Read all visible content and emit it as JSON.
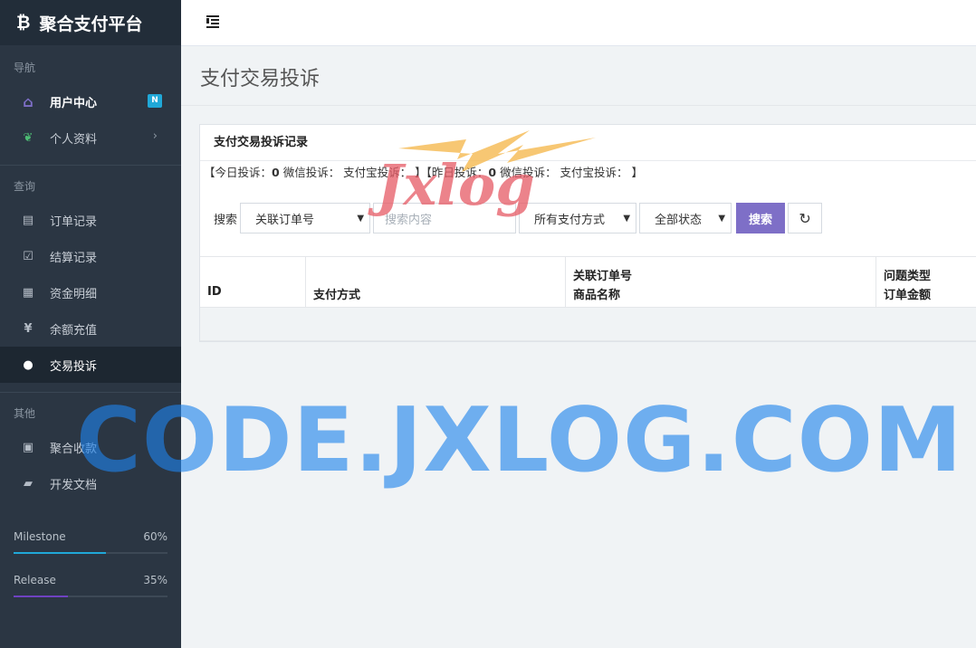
{
  "brand": {
    "logo_glyph": "₿",
    "title": "聚合支付平台"
  },
  "sidebar": {
    "sections": [
      {
        "label": "导航"
      },
      {
        "label": "查询"
      },
      {
        "label": "其他"
      }
    ],
    "items": [
      {
        "label": "用户中心",
        "icon": "home-icon",
        "glyph": "⌂",
        "badge": "N"
      },
      {
        "label": "个人资料",
        "icon": "leaf-icon",
        "glyph": "❦",
        "chevron": "›"
      },
      {
        "label": "订单记录",
        "icon": "list-icon",
        "glyph": "▤"
      },
      {
        "label": "结算记录",
        "icon": "check-square-icon",
        "glyph": "☑"
      },
      {
        "label": "资金明细",
        "icon": "calendar-icon",
        "glyph": "▦"
      },
      {
        "label": "余额充值",
        "icon": "yen-icon",
        "glyph": "¥"
      },
      {
        "label": "交易投诉",
        "icon": "comment-icon",
        "glyph": "💬"
      },
      {
        "label": "聚合收款",
        "icon": "qrcode-icon",
        "glyph": "▣"
      },
      {
        "label": "开发文档",
        "icon": "book-icon",
        "glyph": "▰"
      }
    ],
    "progress": [
      {
        "label": "Milestone",
        "value_text": "60%",
        "value": 0.6,
        "color": "#20a8d8"
      },
      {
        "label": "Release",
        "value_text": "35%",
        "value": 0.35,
        "color": "#6f42c1"
      }
    ]
  },
  "header": {
    "toggle_icon": "menu-indent-icon"
  },
  "page": {
    "title": "支付交易投诉"
  },
  "card": {
    "title": "支付交易投诉记录",
    "stats": {
      "open1": "【今日投诉：",
      "today_count": "0",
      "today_rest": " 微信投诉：  支付宝投诉：  】【昨日投诉：",
      "yesterday_count": "0",
      "yesterday_rest": " 微信投诉：  支付宝投诉：  】"
    },
    "search": {
      "label": "搜索",
      "field_select": "关联订单号",
      "input_placeholder": "搜索内容",
      "pay_select": "所有支付方式",
      "status_select": "全部状态",
      "search_button": "搜索",
      "refresh_icon": "refresh-icon"
    },
    "table": {
      "columns": [
        {
          "line1": "",
          "line2": "ID"
        },
        {
          "line1": "",
          "line2": "支付方式"
        },
        {
          "line1": "关联订单号",
          "line2": "商品名称"
        },
        {
          "line1": "问题类型",
          "line2": "订单金额"
        }
      ]
    }
  },
  "watermark": {
    "big": "CODE.JXLOG.COM",
    "logo": "Jxlog"
  }
}
